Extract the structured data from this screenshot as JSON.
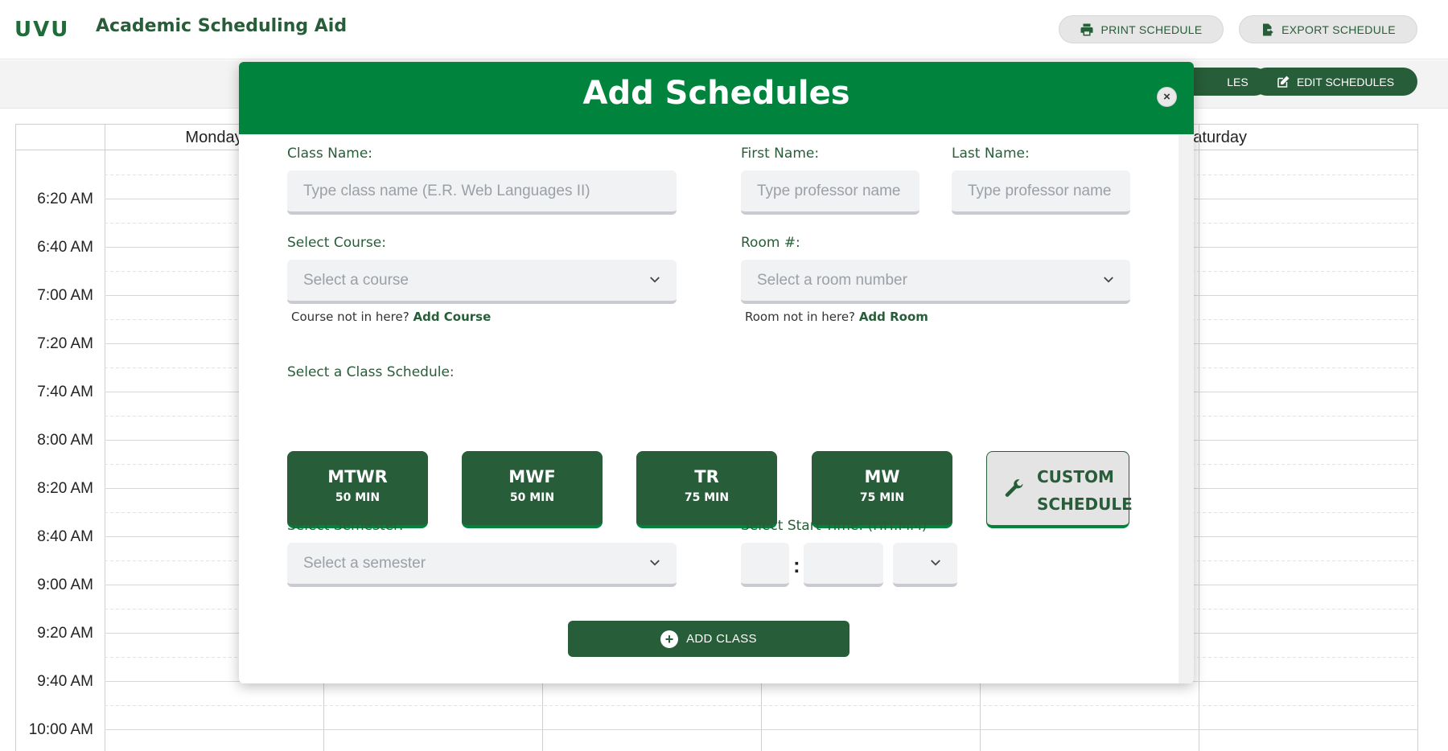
{
  "header": {
    "logo": "UVU",
    "title": "Academic Scheduling Aid",
    "print_label": "PRINT SCHEDULE",
    "export_label": "EXPORT SCHEDULE"
  },
  "toolbar": {
    "partial_label": "LES",
    "edit_label": "EDIT SCHEDULES"
  },
  "calendar": {
    "days": [
      "Monday",
      "Saturday"
    ],
    "times": [
      "6:20 AM",
      "6:40 AM",
      "7:00 AM",
      "7:20 AM",
      "7:40 AM",
      "8:00 AM",
      "8:20 AM",
      "8:40 AM",
      "9:00 AM",
      "9:20 AM",
      "9:40 AM",
      "10:00 AM"
    ]
  },
  "modal": {
    "title": "Add Schedules",
    "close_glyph": "×",
    "class_name": {
      "label": "Class Name:",
      "placeholder": "Type class name (E.R. Web Languages II)",
      "value": ""
    },
    "first_name": {
      "label": "First Name:",
      "placeholder": "Type professor name",
      "value": ""
    },
    "last_name": {
      "label": "Last Name:",
      "placeholder": "Type professor name",
      "value": ""
    },
    "course": {
      "label": "Select Course:",
      "selected": "Select a course",
      "hint": "Course not in here?",
      "hint_link": "Add Course"
    },
    "room": {
      "label": "Room #:",
      "selected": "Select a room number",
      "hint": "Room not in here?",
      "hint_link": "Add Room"
    },
    "schedule_label": "Select a Class Schedule:",
    "schedules": [
      {
        "days": "MTWR",
        "duration": "50 MIN"
      },
      {
        "days": "MWF",
        "duration": "50 MIN"
      },
      {
        "days": "TR",
        "duration": "75 MIN"
      },
      {
        "days": "MW",
        "duration": "75 MIN"
      }
    ],
    "custom_schedule": {
      "line1": "CUSTOM",
      "line2": "SCHEDULE"
    },
    "semester": {
      "label": "Select Semester:",
      "selected": "Select a semester"
    },
    "start_time": {
      "label": "Select Start Time:",
      "format": "(HH:MM)",
      "hour": "",
      "minute": "",
      "ampm": "",
      "separator": ":"
    },
    "add_class_label": "ADD CLASS"
  },
  "colors": {
    "brand_green": "#00843d",
    "dark_green": "#275d38",
    "field_bg": "#f1f2f4"
  }
}
